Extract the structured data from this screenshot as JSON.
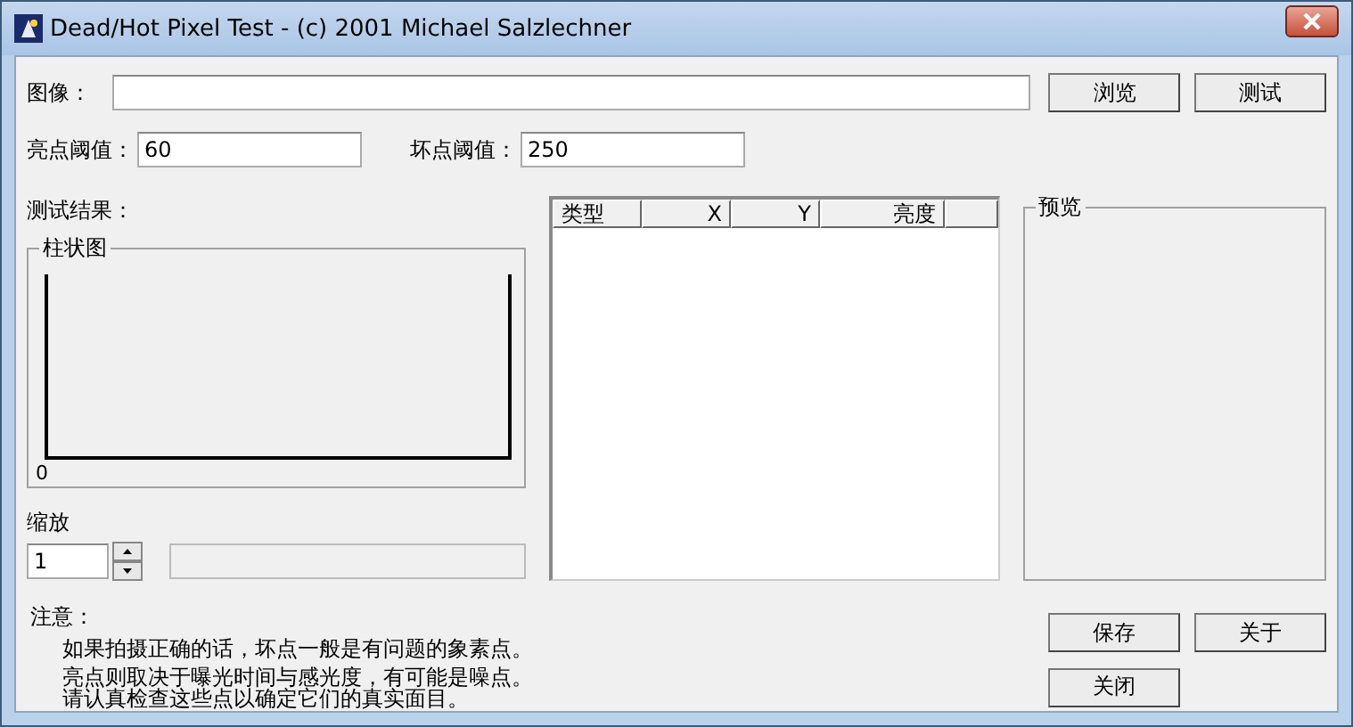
{
  "window": {
    "title": "Dead/Hot Pixel Test - (c) 2001 Michael Salzlechner"
  },
  "image_field": {
    "label": "图像："
  },
  "top_buttons": [
    "浏览",
    "测试"
  ],
  "thresholds": [
    {
      "label": "亮点阈值：",
      "value": "60"
    },
    {
      "label": "坏点阈值：",
      "value": "250"
    }
  ],
  "results_label": "测试结果：",
  "histogram": {
    "title": "柱状图",
    "axis_label": "0"
  },
  "zoom": {
    "label": "缩放",
    "value": "1"
  },
  "table": {
    "columns": [
      {
        "kind": "header",
        "label": "类型"
      },
      {
        "kind": "header",
        "label": "X"
      },
      {
        "kind": "header",
        "label": "Y"
      },
      {
        "kind": "header",
        "label": "亮度"
      },
      {
        "kind": "filler"
      }
    ]
  },
  "preview": {
    "title": "预览"
  },
  "notes": {
    "title": "注意：",
    "lines": [
      "如果拍摄正确的话，坏点一般是有问题的象素点。",
      "亮点则取决于曝光时间与感光度，有可能是噪点。",
      "请认真检查这些点以确定它们的真实面目。"
    ]
  },
  "bottom_buttons": [
    "保存",
    "关于",
    "关闭"
  ]
}
